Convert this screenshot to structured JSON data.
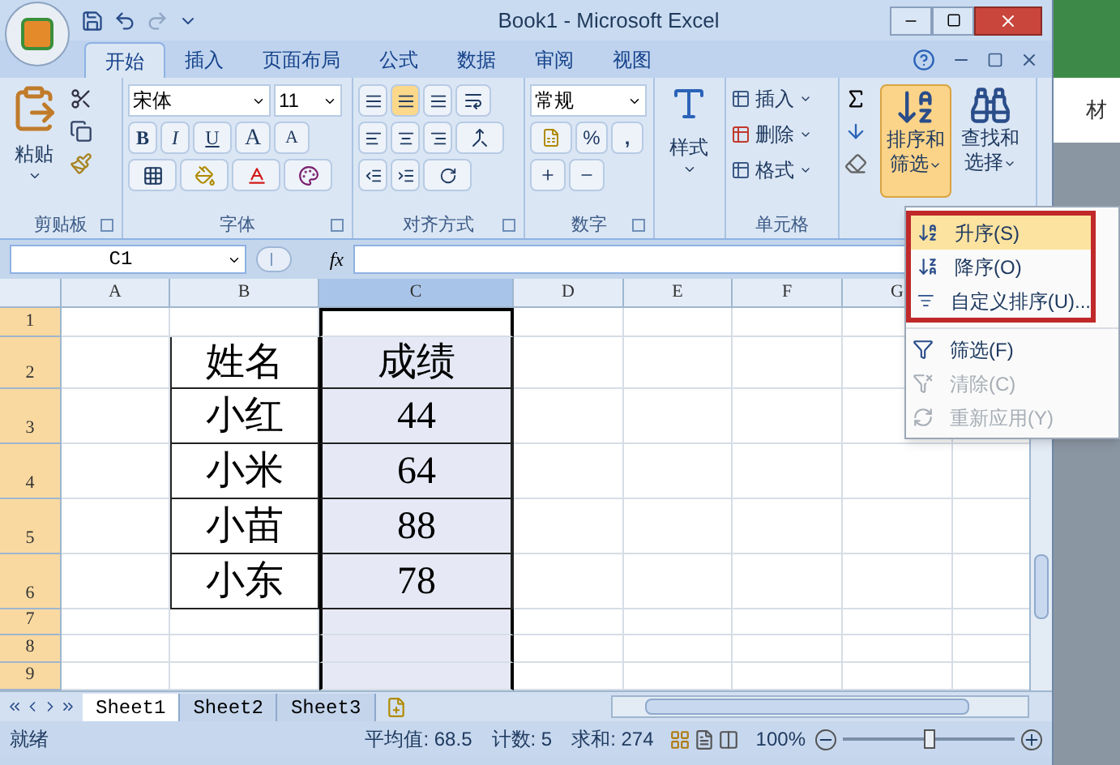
{
  "title_bar": {
    "title": "Book1 - Microsoft Excel"
  },
  "tabs": [
    {
      "label": "开始",
      "selected": true
    },
    {
      "label": "插入",
      "selected": false
    },
    {
      "label": "页面布局",
      "selected": false
    },
    {
      "label": "公式",
      "selected": false
    },
    {
      "label": "数据",
      "selected": false
    },
    {
      "label": "审阅",
      "selected": false
    },
    {
      "label": "视图",
      "selected": false
    }
  ],
  "ribbon": {
    "clipboard": {
      "paste": "粘贴",
      "label": "剪贴板"
    },
    "font": {
      "name": "宋体",
      "size": "11",
      "bold": "B",
      "italic": "I",
      "underline": "U",
      "grow": "A",
      "shrink": "A",
      "label": "字体"
    },
    "alignment": {
      "label": "对齐方式"
    },
    "number": {
      "format": "常规",
      "percent": "%",
      "comma": ",",
      "label": "数字"
    },
    "styles": {
      "button": "样式"
    },
    "cells": {
      "items": [
        "插入",
        "删除",
        "格式"
      ],
      "label": "单元格"
    },
    "editing": {
      "sort_filter": [
        "排序和",
        "筛选"
      ],
      "find_select": [
        "查找和",
        "选择"
      ],
      "sort_filter_active": true
    }
  },
  "formula_bar": {
    "name_box": "C1",
    "fx": "fx"
  },
  "sheet": {
    "columns": [
      {
        "label": "A",
        "selected": false
      },
      {
        "label": "B",
        "selected": false
      },
      {
        "label": "C",
        "selected": true
      },
      {
        "label": "D",
        "selected": false
      },
      {
        "label": "E",
        "selected": false
      },
      {
        "label": "F",
        "selected": false
      },
      {
        "label": "G",
        "selected": false
      }
    ],
    "rows": [
      {
        "number": "1",
        "selected": true
      },
      {
        "number": "2",
        "selected": true,
        "name": "姓名",
        "score": "成绩"
      },
      {
        "number": "3",
        "selected": true,
        "name": "小红",
        "score": "44"
      },
      {
        "number": "4",
        "selected": true,
        "name": "小米",
        "score": "64"
      },
      {
        "number": "5",
        "selected": true,
        "name": "小苗",
        "score": "88"
      },
      {
        "number": "6",
        "selected": true,
        "name": "小东",
        "score": "78"
      },
      {
        "number": "7",
        "selected": true
      },
      {
        "number": "8",
        "selected": true
      },
      {
        "number": "9",
        "selected": true
      }
    ]
  },
  "sort_menu": {
    "groups": [
      {
        "outlined": true,
        "items": [
          {
            "label": "升序(S)",
            "kind": "ascending",
            "selected": true,
            "disabled": false
          },
          {
            "label": "降序(O)",
            "kind": "descending",
            "selected": false,
            "disabled": false
          },
          {
            "label": "自定义排序(U)...",
            "kind": "custom",
            "selected": false,
            "disabled": false
          }
        ]
      },
      {
        "outlined": false,
        "items": [
          {
            "label": "筛选(F)",
            "kind": "filter",
            "selected": false,
            "disabled": false
          },
          {
            "label": "清除(C)",
            "kind": "clear",
            "selected": false,
            "disabled": true
          },
          {
            "label": "重新应用(Y)",
            "kind": "reapply",
            "selected": false,
            "disabled": true
          }
        ]
      }
    ]
  },
  "sheet_tabs": [
    {
      "label": "Sheet1",
      "selected": true
    },
    {
      "label": "Sheet2",
      "selected": false
    },
    {
      "label": "Sheet3",
      "selected": false
    }
  ],
  "status_bar": {
    "state": "就绪",
    "average": "平均值: 68.5",
    "count": "计数: 5",
    "sum": "求和: 274",
    "zoom": "100%",
    "zoom_slider": {
      "level": 0.5
    }
  },
  "background_window": {
    "text": "材"
  }
}
